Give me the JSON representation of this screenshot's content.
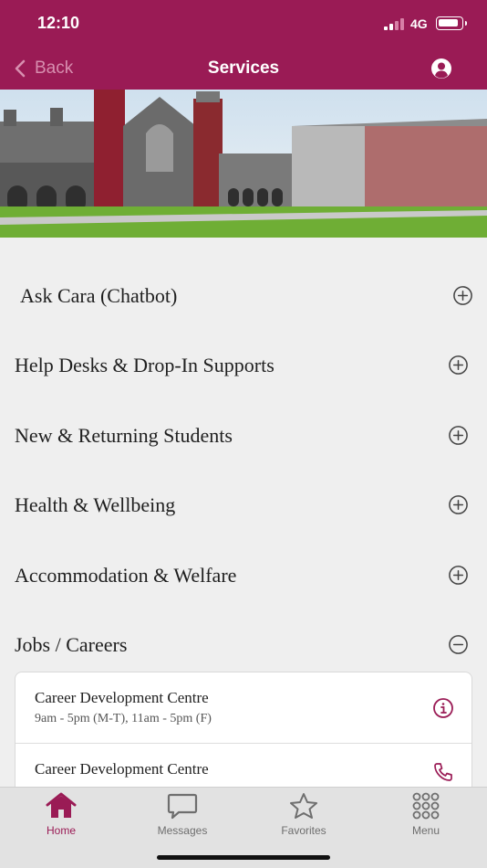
{
  "status_bar": {
    "time": "12:10",
    "network": "4G"
  },
  "nav": {
    "back_label": "Back",
    "title": "Services"
  },
  "accordion": [
    {
      "label": "Ask Cara (Chatbot)",
      "expanded": false
    },
    {
      "label": "Help Desks & Drop-In Supports",
      "expanded": false
    },
    {
      "label": "New & Returning Students",
      "expanded": false
    },
    {
      "label": "Health & Wellbeing",
      "expanded": false
    },
    {
      "label": "Accommodation & Welfare",
      "expanded": false
    },
    {
      "label": "Jobs / Careers",
      "expanded": true
    }
  ],
  "jobs_careers": [
    {
      "title": "Career Development Centre",
      "subtitle": "9am - 5pm (M-T), 11am - 5pm (F)",
      "icon": "info-icon"
    },
    {
      "title": "Career Development Centre",
      "subtitle": "",
      "icon": "phone-icon"
    }
  ],
  "tabs": [
    {
      "label": "Home",
      "icon": "home-icon",
      "active": true
    },
    {
      "label": "Messages",
      "icon": "chat-bubble-icon",
      "active": false
    },
    {
      "label": "Favorites",
      "icon": "star-icon",
      "active": false
    },
    {
      "label": "Menu",
      "icon": "grid-icon",
      "active": false
    }
  ],
  "colors": {
    "brand": "#9a1b55",
    "background": "#efefef",
    "tab_bar": "#e2e2e2"
  }
}
